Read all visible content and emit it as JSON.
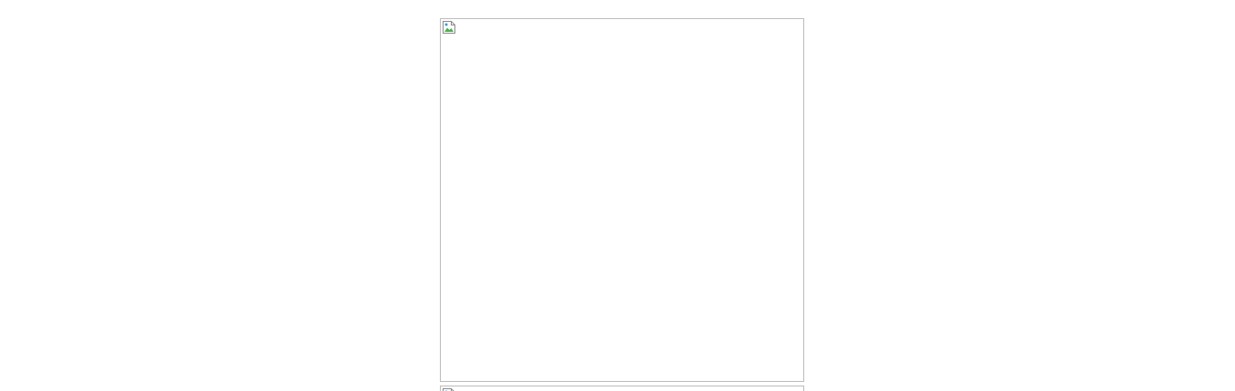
{
  "images": [
    {
      "name": "primary-image",
      "alt": "",
      "icon": "broken-image-icon"
    },
    {
      "name": "secondary-image",
      "alt": "",
      "icon": "broken-image-icon"
    }
  ],
  "colors": {
    "background": "#ffffff",
    "frame_border": "#bcbcbc"
  }
}
